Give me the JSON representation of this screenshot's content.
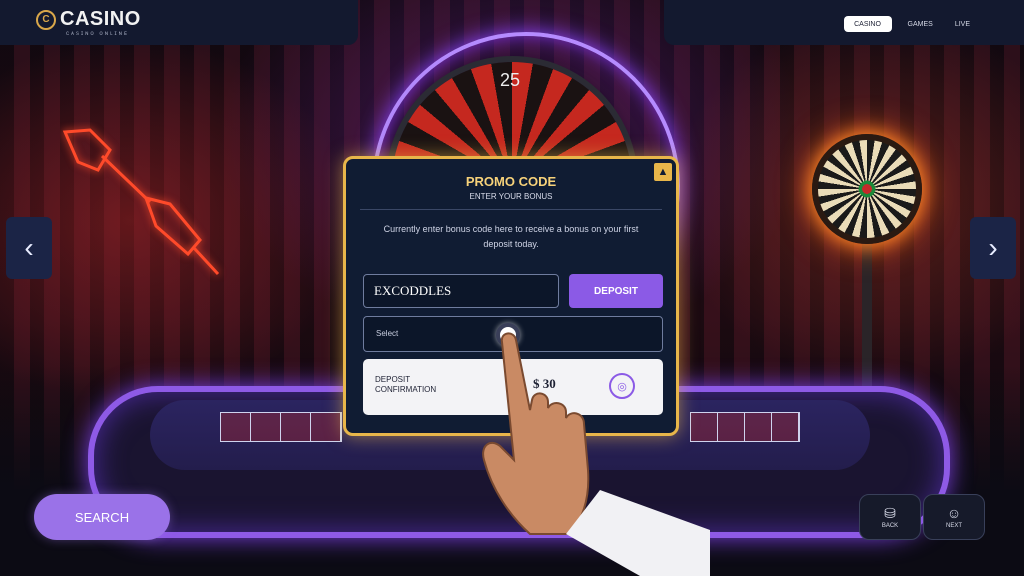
{
  "header": {
    "logo_text": "CASINO",
    "logo_sub": "ᴄᴀsɪɴᴏ ᴏɴʟɪɴᴇ",
    "nav_button": "CASINO",
    "nav_links": [
      "GAMES",
      "LIVE"
    ]
  },
  "scene": {
    "wheel_number": "25"
  },
  "modal": {
    "title": "PROMO CODE",
    "subtitle": "ENTER YOUR BONUS",
    "description": "Currently enter bonus code here to receive a bonus on your first deposit today.",
    "code_value": "EXCODDLES",
    "deposit_label": "DEPOSIT",
    "select_label": "Select",
    "confirm_label_line1": "DEPOSIT",
    "confirm_label_line2": "CONFIRMATION",
    "confirm_amount": "$ 30"
  },
  "controls": {
    "search_label": "SEARCH",
    "tool1_label": "BACK",
    "tool2_label": "NEXT",
    "prev_label": "‹",
    "next_label": "›"
  }
}
